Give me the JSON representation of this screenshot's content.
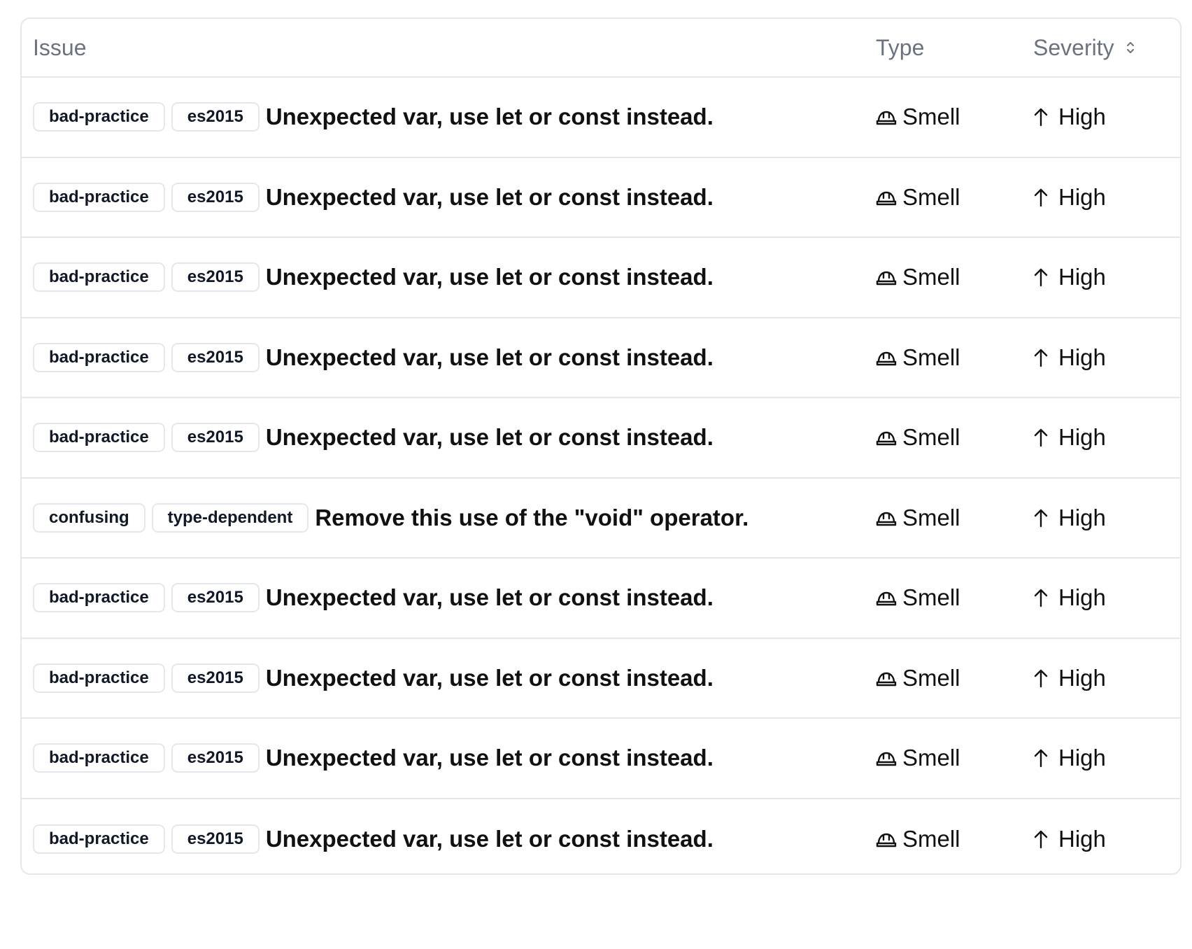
{
  "table": {
    "headers": {
      "issue": "Issue",
      "type": "Type",
      "severity": "Severity"
    },
    "rows": [
      {
        "tags": [
          "bad-practice",
          "es2015"
        ],
        "message": "Unexpected var, use let or const instead.",
        "type": "Smell",
        "severity": "High"
      },
      {
        "tags": [
          "bad-practice",
          "es2015"
        ],
        "message": "Unexpected var, use let or const instead.",
        "type": "Smell",
        "severity": "High"
      },
      {
        "tags": [
          "bad-practice",
          "es2015"
        ],
        "message": "Unexpected var, use let or const instead.",
        "type": "Smell",
        "severity": "High"
      },
      {
        "tags": [
          "bad-practice",
          "es2015"
        ],
        "message": "Unexpected var, use let or const instead.",
        "type": "Smell",
        "severity": "High"
      },
      {
        "tags": [
          "bad-practice",
          "es2015"
        ],
        "message": "Unexpected var, use let or const instead.",
        "type": "Smell",
        "severity": "High"
      },
      {
        "tags": [
          "confusing",
          "type-dependent"
        ],
        "message": "Remove this use of the \"void\" operator.",
        "type": "Smell",
        "severity": "High"
      },
      {
        "tags": [
          "bad-practice",
          "es2015"
        ],
        "message": "Unexpected var, use let or const instead.",
        "type": "Smell",
        "severity": "High"
      },
      {
        "tags": [
          "bad-practice",
          "es2015"
        ],
        "message": "Unexpected var, use let or const instead.",
        "type": "Smell",
        "severity": "High"
      },
      {
        "tags": [
          "bad-practice",
          "es2015"
        ],
        "message": "Unexpected var, use let or const instead.",
        "type": "Smell",
        "severity": "High"
      },
      {
        "tags": [
          "bad-practice",
          "es2015"
        ],
        "message": "Unexpected var, use let or const instead.",
        "type": "Smell",
        "severity": "High"
      }
    ]
  },
  "icons": {
    "type": "hard-hat-icon",
    "severity": "arrow-up-icon",
    "sort": "sort-icon"
  },
  "colors": {
    "border": "#e5e7eb",
    "header_text": "#6b7280",
    "text": "#111111"
  }
}
